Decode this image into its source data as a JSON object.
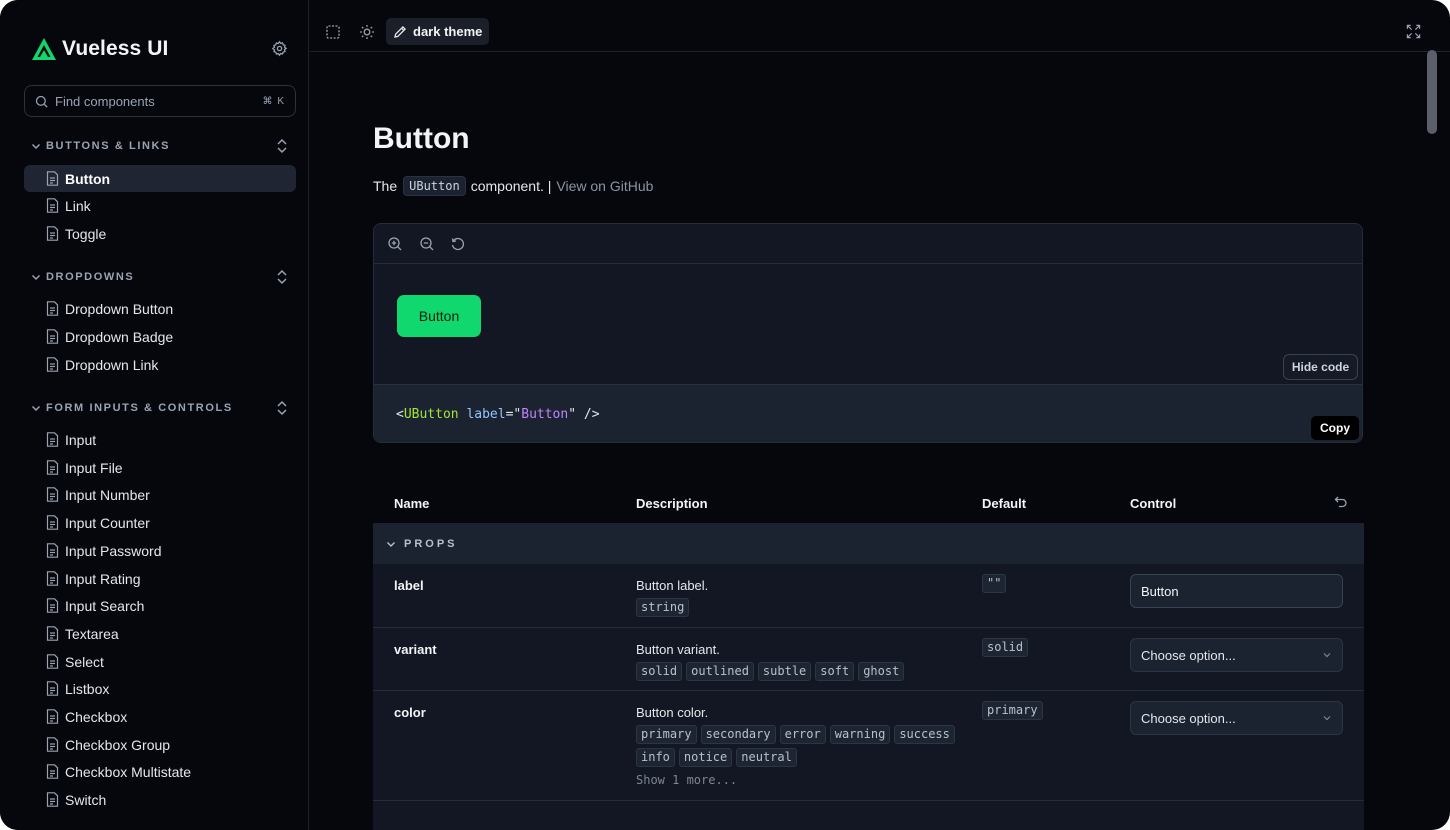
{
  "sidebar": {
    "brand": "Vueless UI",
    "search_placeholder": "Find components",
    "search_shortcut": "⌘ K",
    "groups": [
      {
        "title": "BUTTONS & LINKS",
        "items": [
          {
            "label": "Button",
            "active": true
          },
          {
            "label": "Link"
          },
          {
            "label": "Toggle"
          }
        ]
      },
      {
        "title": "DROPDOWNS",
        "items": [
          {
            "label": "Dropdown Button"
          },
          {
            "label": "Dropdown Badge"
          },
          {
            "label": "Dropdown Link"
          }
        ]
      },
      {
        "title": "FORM INPUTS & CONTROLS",
        "items": [
          {
            "label": "Input"
          },
          {
            "label": "Input File"
          },
          {
            "label": "Input Number"
          },
          {
            "label": "Input Counter"
          },
          {
            "label": "Input Password"
          },
          {
            "label": "Input Rating"
          },
          {
            "label": "Input Search"
          },
          {
            "label": "Textarea"
          },
          {
            "label": "Select"
          },
          {
            "label": "Listbox"
          },
          {
            "label": "Checkbox"
          },
          {
            "label": "Checkbox Group"
          },
          {
            "label": "Checkbox Multistate"
          },
          {
            "label": "Switch"
          }
        ]
      }
    ]
  },
  "toolbar": {
    "theme_label": "dark theme"
  },
  "main": {
    "title": "Button",
    "subtitle_prefix": "The",
    "component_code": "UButton",
    "subtitle_suffix": "component. |",
    "github_link": "View on GitHub",
    "preview": {
      "demo_button_label": "Button",
      "hide_code_label": "Hide code",
      "copy_label": "Copy",
      "code": {
        "open": "<",
        "tag": "UButton",
        "attr": "label",
        "eq": "=\"",
        "value": "Button",
        "close": "\" />"
      }
    },
    "table": {
      "headers": [
        "Name",
        "Description",
        "Default",
        "Control"
      ],
      "section": "PROPS",
      "rows": [
        {
          "name": "label",
          "description": "Button label.",
          "types": [
            "string"
          ],
          "default": "\"\"",
          "control_value": "Button"
        },
        {
          "name": "variant",
          "description": "Button variant.",
          "types": [
            "solid",
            "outlined",
            "subtle",
            "soft",
            "ghost"
          ],
          "default": "solid",
          "control_placeholder": "Choose option..."
        },
        {
          "name": "color",
          "description": "Button color.",
          "types": [
            "primary",
            "secondary",
            "error",
            "warning",
            "success",
            "info",
            "notice",
            "neutral"
          ],
          "default": "primary",
          "control_placeholder": "Choose option...",
          "show_more": "Show 1 more..."
        }
      ]
    }
  },
  "colors": {
    "background": "#05070d",
    "panel": "#121723",
    "accent": "#11d86e"
  }
}
